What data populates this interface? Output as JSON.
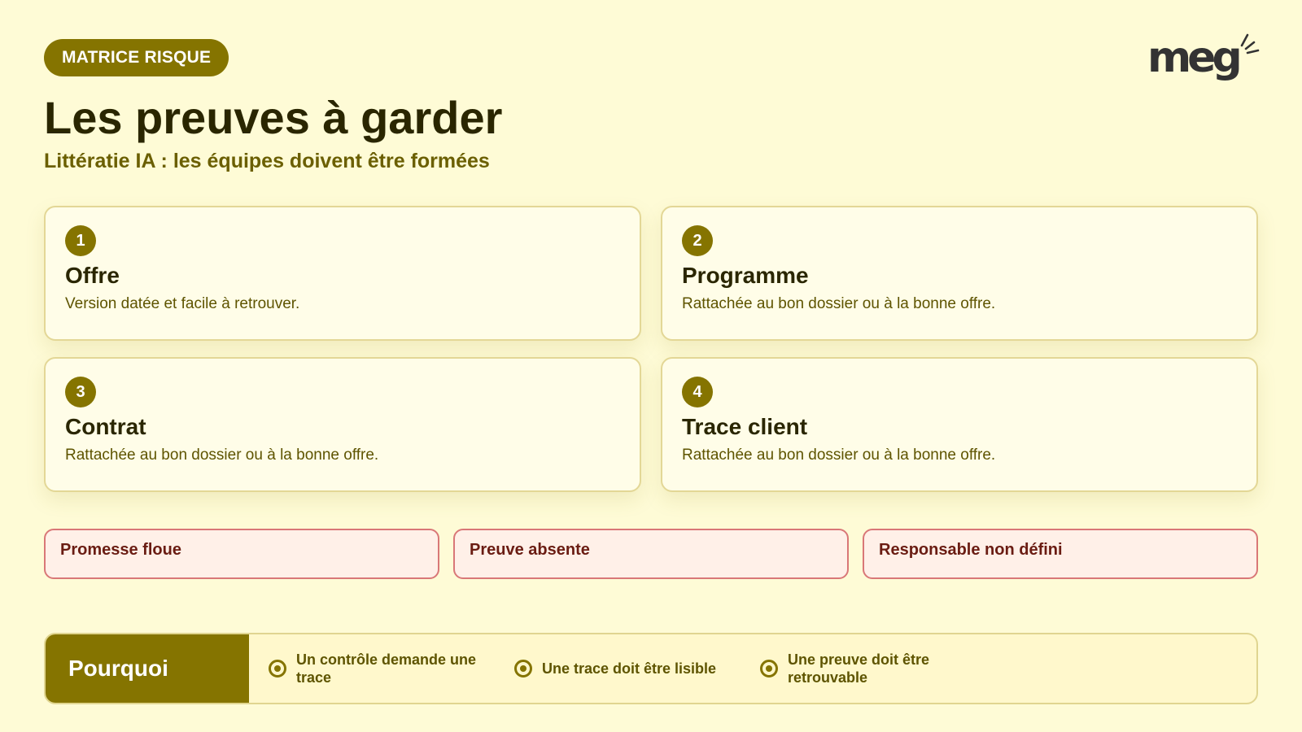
{
  "header": {
    "badge": "MATRICE RISQUE",
    "title": "Les preuves à garder",
    "subtitle": "Littératie IA : les équipes doivent être formées",
    "logo_text": "meg"
  },
  "cards": [
    {
      "number": "1",
      "title": "Offre",
      "description": "Version datée et facile à retrouver."
    },
    {
      "number": "2",
      "title": "Programme",
      "description": "Rattachée au bon dossier ou à la bonne offre."
    },
    {
      "number": "3",
      "title": "Contrat",
      "description": "Rattachée au bon dossier ou à la bonne offre."
    },
    {
      "number": "4",
      "title": "Trace client",
      "description": "Rattachée au bon dossier ou à la bonne offre."
    }
  ],
  "risks": [
    "Promesse floue",
    "Preuve absente",
    "Responsable non défini"
  ],
  "why": {
    "label": "Pourquoi",
    "items": [
      {
        "icon": "target-icon",
        "text": "Un contrôle demande une trace"
      },
      {
        "icon": "target-icon",
        "text": "Une trace doit être lisible"
      },
      {
        "icon": "target-icon",
        "text": "Une preuve doit être retrouvable"
      }
    ]
  },
  "colors": {
    "background": "#fefbd6",
    "accent": "#857400",
    "risk_border": "#d97777",
    "risk_background": "#fff0e8"
  }
}
